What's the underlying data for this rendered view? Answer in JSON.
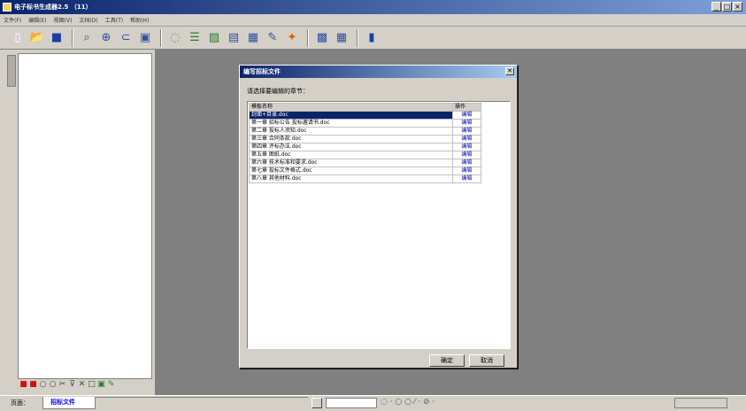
{
  "window": {
    "title": "电子标书生成器2.5 （11）",
    "controls": [
      "_",
      "□",
      "×"
    ]
  },
  "menu": [
    "文件(F)",
    "编辑(E)",
    "视图(V)",
    "文档(D)",
    "工具(T)",
    "帮助(H)"
  ],
  "toolbar": [
    {
      "icon": "new-doc-icon",
      "glyph": "▯",
      "color": "#ffffff"
    },
    {
      "icon": "open-folder-icon",
      "glyph": "📂",
      "color": "#d8a000"
    },
    {
      "icon": "save-icon",
      "glyph": "■",
      "color": "#1b3fa8"
    },
    {
      "sep": true
    },
    {
      "icon": "print-preview-icon",
      "glyph": "⌕",
      "color": "#3050a0"
    },
    {
      "icon": "zoom-icon",
      "glyph": "⊕",
      "color": "#3050a0"
    },
    {
      "icon": "link-icon",
      "glyph": "⊂",
      "color": "#3050a0"
    },
    {
      "icon": "page-setup-icon",
      "glyph": "▣",
      "color": "#3050a0"
    },
    {
      "sep": true
    },
    {
      "icon": "insert-icon",
      "glyph": "◌",
      "color": "#8a8a8a"
    },
    {
      "icon": "table-icon",
      "glyph": "☰",
      "color": "#2f7a2f"
    },
    {
      "icon": "image-icon",
      "glyph": "▨",
      "color": "#2f7a2f"
    },
    {
      "icon": "list-icon",
      "glyph": "▤",
      "color": "#3050a0"
    },
    {
      "icon": "template-icon",
      "glyph": "▦",
      "color": "#3050a0"
    },
    {
      "icon": "tools-icon",
      "glyph": "✎",
      "color": "#3050a0"
    },
    {
      "icon": "fire-icon",
      "glyph": "✦",
      "color": "#e06000"
    },
    {
      "sep": true
    },
    {
      "icon": "window-icon",
      "glyph": "▩",
      "color": "#3050a0"
    },
    {
      "icon": "grid-icon",
      "glyph": "▦",
      "color": "#3050a0"
    },
    {
      "sep": true
    },
    {
      "icon": "book-icon",
      "glyph": "▮",
      "color": "#1b3fa8"
    }
  ],
  "bottom_icons": [
    {
      "icon": "stop-icon",
      "glyph": "■",
      "color": "#cc1111"
    },
    {
      "icon": "record-icon",
      "glyph": "■",
      "color": "#cc1111"
    },
    {
      "icon": "circle-icon",
      "glyph": "○",
      "color": "#444444"
    },
    {
      "icon": "circle2-icon",
      "glyph": "○",
      "color": "#444444"
    },
    {
      "icon": "scissors-icon",
      "glyph": "✂",
      "color": "#444444"
    },
    {
      "icon": "filter-icon",
      "glyph": "⊽",
      "color": "#444444"
    },
    {
      "icon": "delete-icon",
      "glyph": "✕",
      "color": "#444444"
    },
    {
      "icon": "square-icon",
      "glyph": "□",
      "color": "#444444"
    },
    {
      "icon": "grid-small-icon",
      "glyph": "▣",
      "color": "#2f7a2f"
    },
    {
      "icon": "pencil-icon",
      "glyph": "✎",
      "color": "#2f7a2f"
    }
  ],
  "dialog": {
    "title": "编写招标文件",
    "prompt": "请选择要编辑的章节：",
    "columns": [
      "模板名称",
      "操作"
    ],
    "rows": [
      {
        "name": "封面+目录.doc",
        "op": "编辑",
        "selected": true
      },
      {
        "name": "第一章 招标公告 投标邀请书.doc",
        "op": "编辑"
      },
      {
        "name": "第二章 投标人须知.doc",
        "op": "编辑"
      },
      {
        "name": "第三章 合同条款.doc",
        "op": "编辑"
      },
      {
        "name": "第四章 评标办法.doc",
        "op": "编辑"
      },
      {
        "name": "第五章 图纸.doc",
        "op": "编辑"
      },
      {
        "name": "第六章 技术标准和要求.doc",
        "op": "编辑"
      },
      {
        "name": "第七章 投标文件格式.doc",
        "op": "编辑"
      },
      {
        "name": "第八章 其他材料.doc",
        "op": "编辑"
      }
    ],
    "ok_label": "确定",
    "cancel_label": "取消"
  },
  "status": {
    "page_label": "页面：",
    "doc_tab": "招标文件",
    "tools": "◌ · ○ ○ ⁄ · ⊘ ·"
  }
}
